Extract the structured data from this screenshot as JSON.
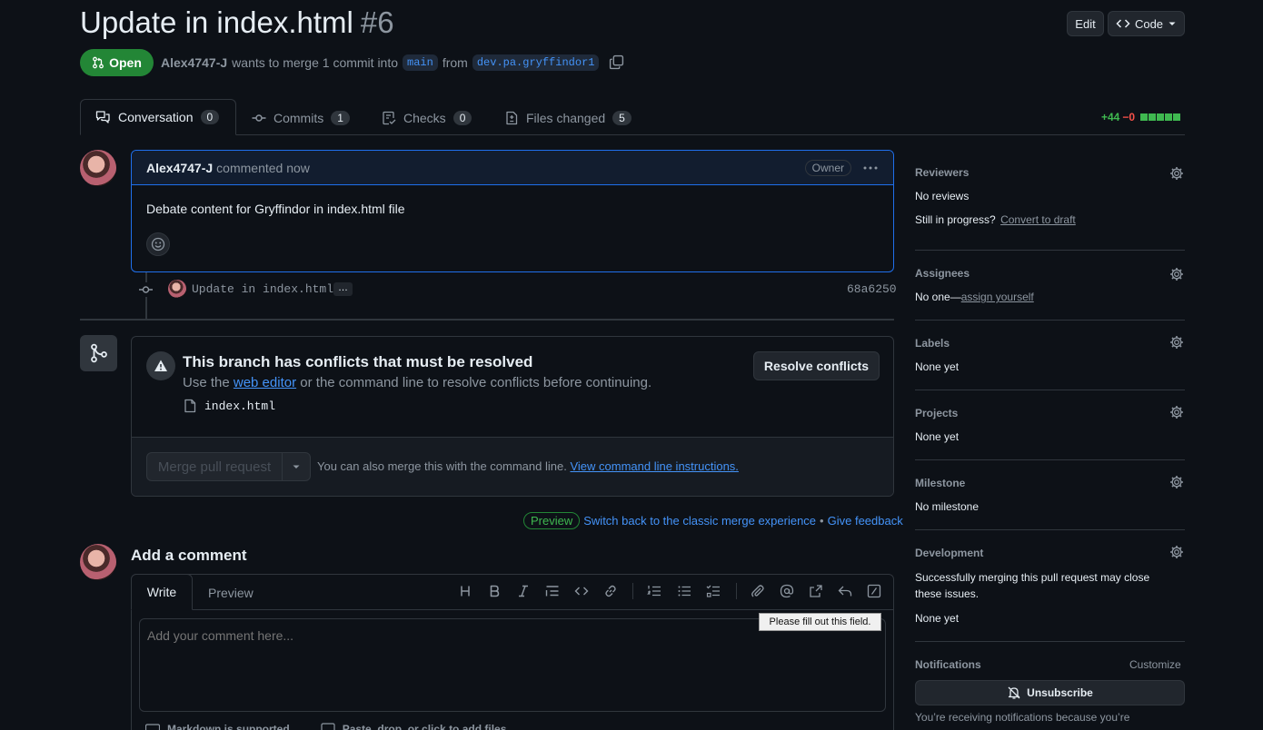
{
  "header": {
    "title": "Update in index.html",
    "number": "#6",
    "edit_label": "Edit",
    "code_label": "Code",
    "status": "Open",
    "author": "Alex4747-J",
    "merge_text": "wants to merge 1 commit into",
    "base_branch": "main",
    "from_text": "from",
    "head_branch": "dev.pa.gryffindor1"
  },
  "tabs": [
    {
      "label": "Conversation",
      "count": "0"
    },
    {
      "label": "Commits",
      "count": "1"
    },
    {
      "label": "Checks",
      "count": "0"
    },
    {
      "label": "Files changed",
      "count": "5"
    }
  ],
  "diffstat": {
    "additions": "+44",
    "deletions": "−0"
  },
  "comment": {
    "author": "Alex4747-J",
    "action": "commented now",
    "badge": "Owner",
    "body": "Debate content for Gryffindor in index.html file"
  },
  "commit": {
    "message": "Update in index.html",
    "more": "…",
    "sha": "68a6250"
  },
  "conflict": {
    "title": "This branch has conflicts that must be resolved",
    "desc_prefix": "Use the",
    "desc_link": "web editor",
    "desc_suffix": "or the command line to resolve conflicts before continuing.",
    "file": "index.html",
    "resolve_label": "Resolve conflicts",
    "merge_label": "Merge pull request",
    "cli_text": "You can also merge this with the command line.",
    "cli_link": "View command line instructions."
  },
  "preview_bar": {
    "badge": "Preview",
    "switch_link": "Switch back to the classic merge experience",
    "sep": "•",
    "feedback_link": "Give feedback"
  },
  "add_comment": {
    "heading": "Add a comment",
    "tab_write": "Write",
    "tab_preview": "Preview",
    "placeholder": "Add your comment here...",
    "tooltip": "Please fill out this field.",
    "footer_markdown": "Markdown is supported",
    "footer_files": "Paste, drop, or click to add files"
  },
  "sidebar": {
    "reviewers": {
      "title": "Reviewers",
      "value": "No reviews",
      "progress": "Still in progress?",
      "draft_link": "Convert to draft"
    },
    "assignees": {
      "title": "Assignees",
      "value": "No one—",
      "assign_link": "assign yourself"
    },
    "labels": {
      "title": "Labels",
      "value": "None yet"
    },
    "projects": {
      "title": "Projects",
      "value": "None yet"
    },
    "milestone": {
      "title": "Milestone",
      "value": "No milestone"
    },
    "development": {
      "title": "Development",
      "desc": "Successfully merging this pull request may close these issues.",
      "value": "None yet"
    },
    "notifications": {
      "title": "Notifications",
      "customize": "Customize",
      "unsubscribe": "Unsubscribe",
      "reason": "You’re receiving notifications because you’re"
    }
  },
  "colors": {
    "open_green": "#238636",
    "link_blue": "#4493f8",
    "add_green": "#3fb950",
    "del_red": "#f85149"
  }
}
